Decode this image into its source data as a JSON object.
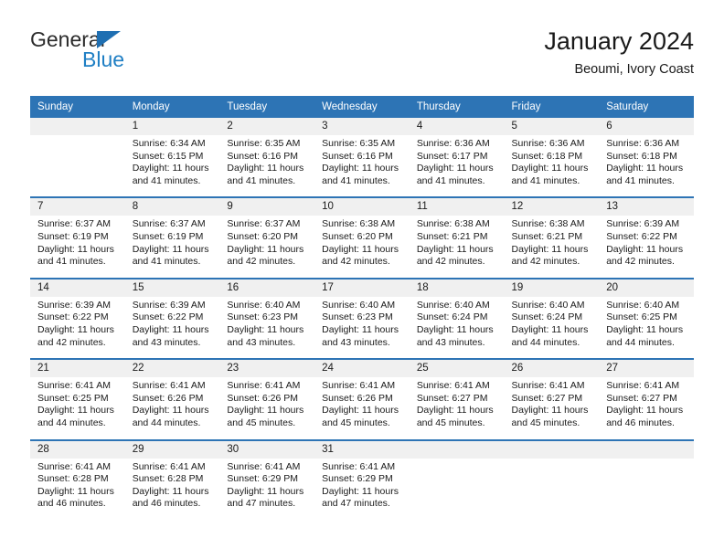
{
  "brand": {
    "name_part1": "General",
    "name_part2": "Blue",
    "triangle_icon": "triangle-logo-icon",
    "colors": {
      "dark": "#2b2b2b",
      "blue": "#1f7fc4",
      "header_blue": "#2d74b5"
    }
  },
  "header": {
    "title": "January 2024",
    "subtitle": "Beoumi, Ivory Coast"
  },
  "calendar": {
    "weekday_headers": [
      "Sunday",
      "Monday",
      "Tuesday",
      "Wednesday",
      "Thursday",
      "Friday",
      "Saturday"
    ],
    "weeks": [
      {
        "days": [
          {
            "num": "",
            "sunrise": "",
            "sunset": "",
            "daylight1": "",
            "daylight2": ""
          },
          {
            "num": "1",
            "sunrise": "Sunrise: 6:34 AM",
            "sunset": "Sunset: 6:15 PM",
            "daylight1": "Daylight: 11 hours",
            "daylight2": "and 41 minutes."
          },
          {
            "num": "2",
            "sunrise": "Sunrise: 6:35 AM",
            "sunset": "Sunset: 6:16 PM",
            "daylight1": "Daylight: 11 hours",
            "daylight2": "and 41 minutes."
          },
          {
            "num": "3",
            "sunrise": "Sunrise: 6:35 AM",
            "sunset": "Sunset: 6:16 PM",
            "daylight1": "Daylight: 11 hours",
            "daylight2": "and 41 minutes."
          },
          {
            "num": "4",
            "sunrise": "Sunrise: 6:36 AM",
            "sunset": "Sunset: 6:17 PM",
            "daylight1": "Daylight: 11 hours",
            "daylight2": "and 41 minutes."
          },
          {
            "num": "5",
            "sunrise": "Sunrise: 6:36 AM",
            "sunset": "Sunset: 6:18 PM",
            "daylight1": "Daylight: 11 hours",
            "daylight2": "and 41 minutes."
          },
          {
            "num": "6",
            "sunrise": "Sunrise: 6:36 AM",
            "sunset": "Sunset: 6:18 PM",
            "daylight1": "Daylight: 11 hours",
            "daylight2": "and 41 minutes."
          }
        ]
      },
      {
        "days": [
          {
            "num": "7",
            "sunrise": "Sunrise: 6:37 AM",
            "sunset": "Sunset: 6:19 PM",
            "daylight1": "Daylight: 11 hours",
            "daylight2": "and 41 minutes."
          },
          {
            "num": "8",
            "sunrise": "Sunrise: 6:37 AM",
            "sunset": "Sunset: 6:19 PM",
            "daylight1": "Daylight: 11 hours",
            "daylight2": "and 41 minutes."
          },
          {
            "num": "9",
            "sunrise": "Sunrise: 6:37 AM",
            "sunset": "Sunset: 6:20 PM",
            "daylight1": "Daylight: 11 hours",
            "daylight2": "and 42 minutes."
          },
          {
            "num": "10",
            "sunrise": "Sunrise: 6:38 AM",
            "sunset": "Sunset: 6:20 PM",
            "daylight1": "Daylight: 11 hours",
            "daylight2": "and 42 minutes."
          },
          {
            "num": "11",
            "sunrise": "Sunrise: 6:38 AM",
            "sunset": "Sunset: 6:21 PM",
            "daylight1": "Daylight: 11 hours",
            "daylight2": "and 42 minutes."
          },
          {
            "num": "12",
            "sunrise": "Sunrise: 6:38 AM",
            "sunset": "Sunset: 6:21 PM",
            "daylight1": "Daylight: 11 hours",
            "daylight2": "and 42 minutes."
          },
          {
            "num": "13",
            "sunrise": "Sunrise: 6:39 AM",
            "sunset": "Sunset: 6:22 PM",
            "daylight1": "Daylight: 11 hours",
            "daylight2": "and 42 minutes."
          }
        ]
      },
      {
        "days": [
          {
            "num": "14",
            "sunrise": "Sunrise: 6:39 AM",
            "sunset": "Sunset: 6:22 PM",
            "daylight1": "Daylight: 11 hours",
            "daylight2": "and 42 minutes."
          },
          {
            "num": "15",
            "sunrise": "Sunrise: 6:39 AM",
            "sunset": "Sunset: 6:22 PM",
            "daylight1": "Daylight: 11 hours",
            "daylight2": "and 43 minutes."
          },
          {
            "num": "16",
            "sunrise": "Sunrise: 6:40 AM",
            "sunset": "Sunset: 6:23 PM",
            "daylight1": "Daylight: 11 hours",
            "daylight2": "and 43 minutes."
          },
          {
            "num": "17",
            "sunrise": "Sunrise: 6:40 AM",
            "sunset": "Sunset: 6:23 PM",
            "daylight1": "Daylight: 11 hours",
            "daylight2": "and 43 minutes."
          },
          {
            "num": "18",
            "sunrise": "Sunrise: 6:40 AM",
            "sunset": "Sunset: 6:24 PM",
            "daylight1": "Daylight: 11 hours",
            "daylight2": "and 43 minutes."
          },
          {
            "num": "19",
            "sunrise": "Sunrise: 6:40 AM",
            "sunset": "Sunset: 6:24 PM",
            "daylight1": "Daylight: 11 hours",
            "daylight2": "and 44 minutes."
          },
          {
            "num": "20",
            "sunrise": "Sunrise: 6:40 AM",
            "sunset": "Sunset: 6:25 PM",
            "daylight1": "Daylight: 11 hours",
            "daylight2": "and 44 minutes."
          }
        ]
      },
      {
        "days": [
          {
            "num": "21",
            "sunrise": "Sunrise: 6:41 AM",
            "sunset": "Sunset: 6:25 PM",
            "daylight1": "Daylight: 11 hours",
            "daylight2": "and 44 minutes."
          },
          {
            "num": "22",
            "sunrise": "Sunrise: 6:41 AM",
            "sunset": "Sunset: 6:26 PM",
            "daylight1": "Daylight: 11 hours",
            "daylight2": "and 44 minutes."
          },
          {
            "num": "23",
            "sunrise": "Sunrise: 6:41 AM",
            "sunset": "Sunset: 6:26 PM",
            "daylight1": "Daylight: 11 hours",
            "daylight2": "and 45 minutes."
          },
          {
            "num": "24",
            "sunrise": "Sunrise: 6:41 AM",
            "sunset": "Sunset: 6:26 PM",
            "daylight1": "Daylight: 11 hours",
            "daylight2": "and 45 minutes."
          },
          {
            "num": "25",
            "sunrise": "Sunrise: 6:41 AM",
            "sunset": "Sunset: 6:27 PM",
            "daylight1": "Daylight: 11 hours",
            "daylight2": "and 45 minutes."
          },
          {
            "num": "26",
            "sunrise": "Sunrise: 6:41 AM",
            "sunset": "Sunset: 6:27 PM",
            "daylight1": "Daylight: 11 hours",
            "daylight2": "and 45 minutes."
          },
          {
            "num": "27",
            "sunrise": "Sunrise: 6:41 AM",
            "sunset": "Sunset: 6:27 PM",
            "daylight1": "Daylight: 11 hours",
            "daylight2": "and 46 minutes."
          }
        ]
      },
      {
        "days": [
          {
            "num": "28",
            "sunrise": "Sunrise: 6:41 AM",
            "sunset": "Sunset: 6:28 PM",
            "daylight1": "Daylight: 11 hours",
            "daylight2": "and 46 minutes."
          },
          {
            "num": "29",
            "sunrise": "Sunrise: 6:41 AM",
            "sunset": "Sunset: 6:28 PM",
            "daylight1": "Daylight: 11 hours",
            "daylight2": "and 46 minutes."
          },
          {
            "num": "30",
            "sunrise": "Sunrise: 6:41 AM",
            "sunset": "Sunset: 6:29 PM",
            "daylight1": "Daylight: 11 hours",
            "daylight2": "and 47 minutes."
          },
          {
            "num": "31",
            "sunrise": "Sunrise: 6:41 AM",
            "sunset": "Sunset: 6:29 PM",
            "daylight1": "Daylight: 11 hours",
            "daylight2": "and 47 minutes."
          },
          {
            "num": "",
            "sunrise": "",
            "sunset": "",
            "daylight1": "",
            "daylight2": ""
          },
          {
            "num": "",
            "sunrise": "",
            "sunset": "",
            "daylight1": "",
            "daylight2": ""
          },
          {
            "num": "",
            "sunrise": "",
            "sunset": "",
            "daylight1": "",
            "daylight2": ""
          }
        ]
      }
    ]
  }
}
